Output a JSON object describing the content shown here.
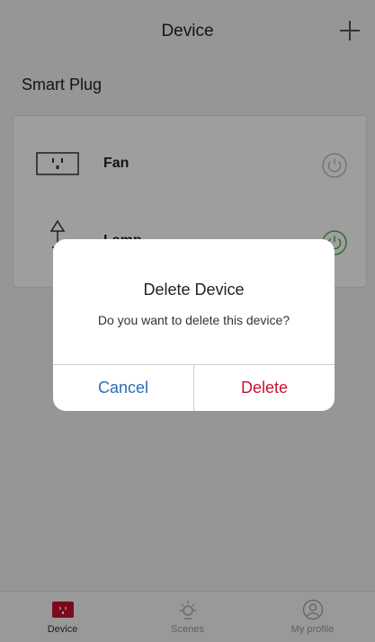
{
  "header": {
    "title": "Device"
  },
  "section": {
    "title": "Smart Plug"
  },
  "devices": [
    {
      "name": "Fan",
      "icon": "outlet-icon",
      "power_state": "off"
    },
    {
      "name": "Lamp",
      "icon": "lamp-icon",
      "power_state": "on"
    }
  ],
  "tabs": [
    {
      "label": "Device",
      "icon": "plug-icon",
      "active": true
    },
    {
      "label": "Scenes",
      "icon": "sun-icon",
      "active": false
    },
    {
      "label": "My profile",
      "icon": "user-icon",
      "active": false
    }
  ],
  "dialog": {
    "title": "Delete Device",
    "message": "Do you want to delete this device?",
    "cancel_label": "Cancel",
    "delete_label": "Delete"
  },
  "colors": {
    "accent_red": "#c8102e",
    "link_blue": "#2a6fb5",
    "power_on_green": "#4caf50",
    "power_off_gray": "#bdbdbd"
  }
}
